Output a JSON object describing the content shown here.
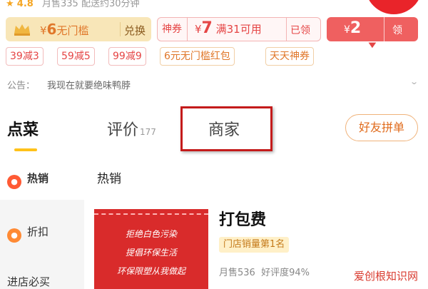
{
  "header": {
    "rating": "4.8",
    "monthly_sales": "月售335",
    "delivery": "配送约30分钟"
  },
  "coupons": {
    "member": {
      "value_prefix": "¥",
      "value": "6",
      "desc": "无门槛",
      "action": "兑换"
    },
    "god": {
      "tag": "神券",
      "value_prefix": "¥",
      "value": "7",
      "desc": "满31可用",
      "action": "已领"
    },
    "red": {
      "value_prefix": "¥",
      "value": "2",
      "action": "领"
    }
  },
  "discount_chips": [
    "39减3",
    "59减5",
    "99减9",
    "6元无门槛红包",
    "天天神券"
  ],
  "notice": {
    "label": "公告：",
    "text": "我现在就要绝味鸭脖"
  },
  "tabs": {
    "order": "点菜",
    "reviews": "评价",
    "reviews_count": "177",
    "merchant": "商家",
    "group_button": "好友拼单"
  },
  "sidebar": {
    "items": [
      {
        "label": "热销",
        "icon": "fire-icon"
      },
      {
        "label": "折扣",
        "icon": "discount-icon"
      },
      {
        "label": "进店必买"
      }
    ]
  },
  "section": {
    "title": "热销"
  },
  "product": {
    "name": "打包费",
    "badge": "门店销量第1名",
    "monthly_sales": "月售536",
    "rating": "好评度94%",
    "image_lines": [
      "拒绝白色污染",
      "提倡环保生活",
      "环保限塑从我做起"
    ]
  },
  "watermark": "爱创根知识网",
  "colors": {
    "accent_red": "#e54545",
    "gold": "#e0772a",
    "tab_underline": "#ffc21a",
    "highlight": "#c41b1b"
  }
}
